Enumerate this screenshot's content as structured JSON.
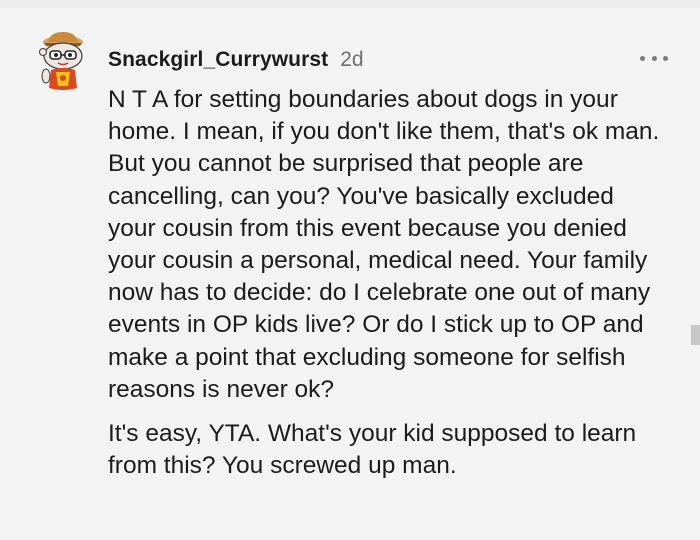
{
  "comment": {
    "username": "Snackgirl_Currywurst",
    "age": "2d",
    "avatar_icon": "snoo-avatar-icon",
    "more_icon": "more-options-icon",
    "paragraphs": [
      "N T A for setting boundaries about dogs in your home. I mean, if you don't like them, that's ok man. But you cannot be surprised that people are cancelling, can you? You've basically excluded your cousin from this event because you denied your cousin a personal, medical need. Your family now has to decide: do I celebrate one out of many events in OP kids live? Or do I stick up to OP and make a point that excluding someone for selfish reasons is never ok?",
      "It's easy, YTA. What's your kid supposed to learn from this? You screwed up man."
    ]
  },
  "colors": {
    "background": "#f3f3f3",
    "text": "#1c1c1c",
    "muted": "#6f6f6f",
    "avatar_head": "#e8e3de",
    "avatar_accent": "#d94a1e",
    "avatar_yellow": "#f2c21b"
  }
}
